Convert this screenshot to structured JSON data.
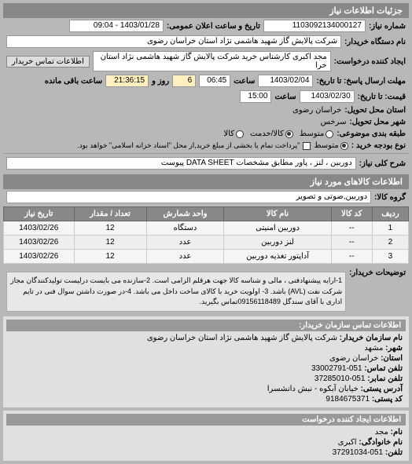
{
  "header": {
    "section_title": "جزئیات اطلاعات نیاز",
    "request_no_label": "شماره نیاز:",
    "request_no": "1103092134000127",
    "announce_label": "تاریخ و ساعت اعلان عمومی:",
    "announce_value": "1403/01/28 - 09:04",
    "org_label": "نام دستگاه خریدار:",
    "org_value": "شرکت پالایش گاز شهید هاشمی نژاد    استان خراسان رضوی",
    "requester_label": "ایجاد کننده درخواست:",
    "requester_value": "مجد اکبری کارشناس خرید شرکت پالایش گاز شهید هاشمی نژاد    استان خرا",
    "buyer_contact_btn": "اطلاعات تماس خریدار"
  },
  "deadlines": {
    "reply_until_label": "مهلت ارسال پاسخ: تا تاریخ:",
    "reply_date": "1403/02/04",
    "reply_time_label": "ساعت",
    "reply_time": "06:45",
    "days_label": "روز و",
    "days": "6",
    "remain_label": "ساعت باقی مانده",
    "remain_time": "21:36:15",
    "quote_until_label": "قیمت: تا تاریخ:",
    "quote_date": "1403/02/30",
    "quote_time_label": "ساعت",
    "quote_time": "15:00"
  },
  "location": {
    "province_label": "استان محل تحویل:",
    "province": "خراسان رضوی",
    "city_label": "شهر محل تحویل:",
    "city": "سرخس"
  },
  "classification": {
    "group_label": "طبقه بندی موضوعی:",
    "group_options": [
      "متوسط",
      "کالا/خدمت",
      "کالا"
    ],
    "group_checked_index": 1,
    "budget_label": "نوع بودجه خرید :",
    "budget_options": [
      "متوسط"
    ],
    "budget_note": "\"پرداخت تمام یا بخشی از مبلغ خرید,از محل \"اسناد خزانه اسلامی\" خواهد بود.",
    "checkbox_checked": false
  },
  "need": {
    "title_label": "شرح کلی نیاز:",
    "title_value": "دوربین ، لنز ، پاور مطابق مشخصات DATA SHEET پیوست"
  },
  "goods": {
    "section_title": "اطلاعات کالاهای مورد نیاز",
    "group_label": "گروه کالا:",
    "group_value": "دوربین,صوتی و تصویر",
    "columns": [
      "ردیف",
      "کد کالا",
      "نام کالا",
      "واحد شمارش",
      "تعداد / مقدار",
      "تاریخ نیاز"
    ],
    "rows": [
      {
        "idx": "1",
        "code": "--",
        "name": "دوربین امنیتی",
        "unit": "دستگاه",
        "qty": "12",
        "date": "1403/02/26"
      },
      {
        "idx": "2",
        "code": "--",
        "name": "لنز دوربین",
        "unit": "عدد",
        "qty": "12",
        "date": "1403/02/26"
      },
      {
        "idx": "3",
        "code": "--",
        "name": "آداپتور تغذیه دوربین",
        "unit": "عدد",
        "qty": "12",
        "date": "1403/02/26"
      }
    ]
  },
  "notes": {
    "label": "توضیحات خریدار:",
    "text": "1-ارایه پیشنهادفنی ، مالی و شناسه کالا جهت هرقلم الزامی است. 2-سازنده می بایست درلیست تولیدکنندگان مجاز شرکت نفت (AVL) باشد. 3- اولویت خرید با کالای ساخت داخل می باشد. 4-در صورت داشتن سوال فنی در تایم اداری با آقای سندگل 09156118489تماس بگیرید."
  },
  "buyer_contact": {
    "section_title": "اطلاعات تماس سازمان خریدار:",
    "org_label": "نام سازمان خریدار:",
    "org": "شرکت پالایش گاز شهید هاشمی نژاد استان خراسان رضوی",
    "city_label": "شهر:",
    "city": "مشهد",
    "province_label": "استان:",
    "province": "خراسان رضوی",
    "tel_label": "تلفن تماس:",
    "tel": "051-33002791",
    "fax_label": "تلفن نمابر:",
    "fax": "051-37285010",
    "address_label": "آدرس پستی:",
    "address": "خیابان آبکوه - نبش دانشسرا",
    "postal_label": "کد پستی:",
    "postal": "9184675371"
  },
  "creator": {
    "section_title": "اطلاعات ایجاد کننده درخواست",
    "name_label": "نام:",
    "name": "مجد",
    "family_label": "نام خانوادگی:",
    "family": "اکبری",
    "tel_label": "تلفن:",
    "tel": "051-37291034"
  }
}
